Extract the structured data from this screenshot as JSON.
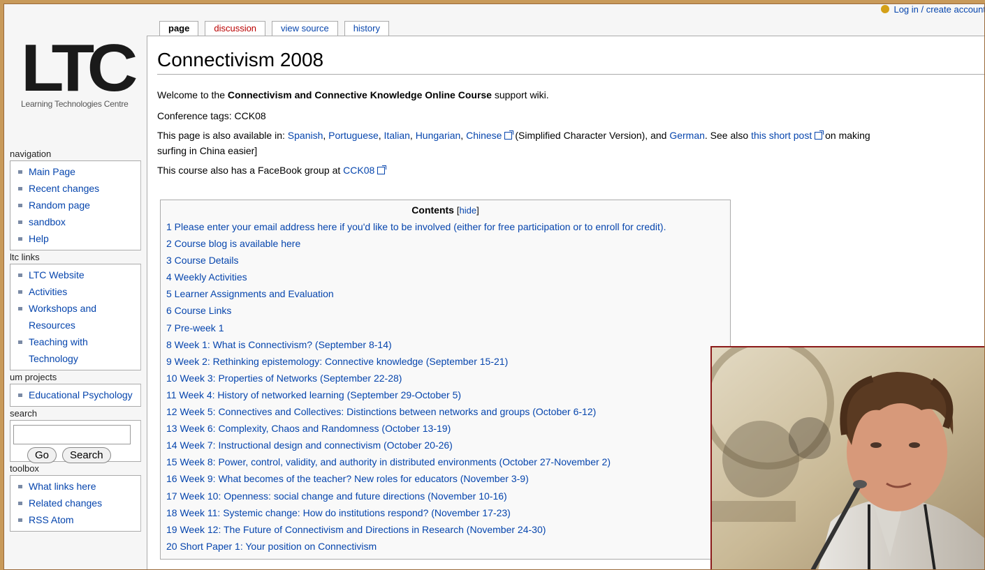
{
  "header": {
    "login_text": "Log in / create account",
    "tabs": [
      {
        "label": "page"
      },
      {
        "label": "discussion"
      },
      {
        "label": "view source"
      },
      {
        "label": "history"
      }
    ]
  },
  "logo": {
    "text": "LTC",
    "subtitle": "Learning Technologies Centre"
  },
  "sidebar": {
    "navigation": {
      "title": "navigation",
      "items": [
        "Main Page",
        "Recent changes",
        "Random page",
        "sandbox",
        "Help"
      ]
    },
    "ltc_links": {
      "title": "ltc links",
      "items": [
        "LTC Website",
        "Activities",
        "Workshops and Resources",
        "Teaching with Technology"
      ]
    },
    "um_projects": {
      "title": "um projects",
      "items": [
        "Educational Psychology"
      ]
    },
    "search": {
      "title": "search",
      "go_label": "Go",
      "search_label": "Search"
    },
    "toolbox": {
      "title": "toolbox",
      "items": [
        "What links here",
        "Related changes",
        "RSS Atom"
      ]
    }
  },
  "main": {
    "title": "Connectivism 2008",
    "welcome": {
      "pre": "Welcome to the ",
      "bold": "Connectivism and Connective Knowledge Online Course",
      "post": " support wiki."
    },
    "conference_tags": "Conference tags: CCK08",
    "languages": {
      "pre": "This page is also available in: ",
      "spanish": "Spanish",
      "portuguese": "Portuguese",
      "italian": "Italian",
      "hungarian": "Hungarian",
      "chinese": "Chinese",
      "mid1": " (Simplified Character Version), and ",
      "german": "German",
      "mid2": ". See also ",
      "short_post": "this short post",
      "post": " on making",
      "line2": "surfing in China easier]"
    },
    "facebook": {
      "pre": "This course also has a FaceBook group at ",
      "link": "CCK08"
    },
    "toc": {
      "title": "Contents",
      "hide_label": "hide",
      "items": [
        "1 Please enter your email address here if you'd like to be involved (either for free participation or to enroll for credit).",
        "2 Course blog is available here",
        "3 Course Details",
        "4 Weekly Activities",
        "5 Learner Assignments and Evaluation",
        "6 Course Links",
        "7 Pre-week 1",
        "8 Week 1: What is Connectivism? (September 8-14)",
        "9 Week 2: Rethinking epistemology: Connective knowledge (September 15-21)",
        "10 Week 3: Properties of Networks (September 22-28)",
        "11 Week 4: History of networked learning (September 29-October 5)",
        "12 Week 5: Connectives and Collectives: Distinctions between networks and groups (October 6-12)",
        "13 Week 6: Complexity, Chaos and Randomness (October 13-19)",
        "14 Week 7: Instructional design and connectivism (October 20-26)",
        "15 Week 8: Power, control, validity, and authority in distributed environments (October 27-November 2)",
        "16 Week 9: What becomes of the teacher? New roles for educators (November 3-9)",
        "17 Week 10: Openness: social change and future directions (November 10-16)",
        "18 Week 11: Systemic change: How do institutions respond? (November 17-23)",
        "19 Week 12: The Future of Connectivism and Directions in Research (November 24-30)",
        "20 Short Paper 1: Your position on Connectivism"
      ]
    }
  },
  "colors": {
    "link": "#0645ad",
    "new_link": "#ba0000",
    "background_frame": "#c89a5a",
    "photo_border": "#8b1a1a"
  }
}
